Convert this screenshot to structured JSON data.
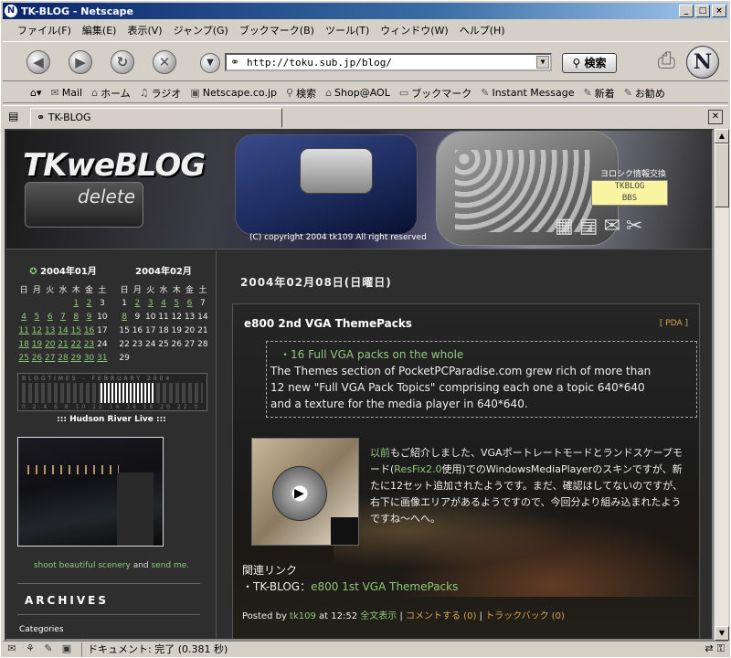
{
  "window": {
    "title": "TK-BLOG - Netscape"
  },
  "menu": [
    "ファイル(F)",
    "編集(E)",
    "表示(V)",
    "ジャンプ(G)",
    "ブックマーク(B)",
    "ツール(T)",
    "ウィンドウ(W)",
    "ヘルプ(H)"
  ],
  "nav": {
    "url": "http://toku.sub.jp/blog/",
    "search_label": "検索",
    "logo": "N"
  },
  "bookmarks": [
    {
      "icon": "mail-icon",
      "glyph": "✉",
      "label": "Mail"
    },
    {
      "icon": "home-icon",
      "glyph": "⌂",
      "label": "ホーム"
    },
    {
      "icon": "radio-icon",
      "glyph": "♫",
      "label": "ラジオ"
    },
    {
      "icon": "netscape-icon",
      "glyph": "▣",
      "label": "Netscape.co.jp"
    },
    {
      "icon": "search-icon",
      "glyph": "⚲",
      "label": "検索"
    },
    {
      "icon": "shop-icon",
      "glyph": "⌂",
      "label": "Shop@AOL"
    },
    {
      "icon": "folder-icon",
      "glyph": "▭",
      "label": "ブックマーク"
    },
    {
      "icon": "im-icon",
      "glyph": "✎",
      "label": "Instant Message"
    },
    {
      "icon": "new-icon",
      "glyph": "✎",
      "label": "新着"
    },
    {
      "icon": "rec-icon",
      "glyph": "✎",
      "label": "お勧め"
    }
  ],
  "tab": {
    "label": "TK-BLOG"
  },
  "status": {
    "text": "ドキュメント: 完了 (0.381 秒)"
  },
  "banner": {
    "logo": "TKweBLOG",
    "key_label": "delete",
    "copyright": "(C) copyright 2004 tk109 All right reserved",
    "yoroshiku": "ヨロシク情報交換",
    "bbs": "TKBLOG\nBBS"
  },
  "sidebar": {
    "cal1": {
      "title": "2004年01月",
      "days": [
        "日",
        "月",
        "火",
        "水",
        "木",
        "金",
        "土"
      ],
      "rows": [
        [
          "",
          "",
          "",
          "",
          "1",
          "2",
          "3"
        ],
        [
          "4",
          "5",
          "6",
          "7",
          "8",
          "9",
          "10"
        ],
        [
          "11",
          "12",
          "13",
          "14",
          "15",
          "16",
          "17"
        ],
        [
          "18",
          "19",
          "20",
          "21",
          "22",
          "23",
          "24"
        ],
        [
          "25",
          "26",
          "27",
          "28",
          "29",
          "30",
          "31"
        ]
      ],
      "linked": [
        "1",
        "2",
        "4",
        "5",
        "6",
        "7",
        "8",
        "9",
        "11",
        "12",
        "13",
        "14",
        "15",
        "16",
        "18",
        "19",
        "20",
        "21",
        "22",
        "23",
        "25",
        "26",
        "27",
        "28",
        "29",
        "30",
        "31"
      ]
    },
    "cal2": {
      "title": "2004年02月",
      "days": [
        "日",
        "月",
        "火",
        "水",
        "木",
        "金",
        "土"
      ],
      "rows": [
        [
          "1",
          "2",
          "3",
          "4",
          "5",
          "6",
          "7"
        ],
        [
          "8",
          "9",
          "10",
          "11",
          "12",
          "13",
          "14"
        ],
        [
          "15",
          "16",
          "17",
          "18",
          "19",
          "20",
          "21"
        ],
        [
          "22",
          "23",
          "24",
          "25",
          "26",
          "27",
          "28"
        ],
        [
          "29",
          "",
          "",
          "",
          "",
          "",
          ""
        ]
      ],
      "linked": [
        "2",
        "3",
        "4",
        "5",
        "6",
        "8"
      ]
    },
    "blogtimes_label": "BLOGTIMES - FEBRUARY 2004",
    "blogtimes_hours": "0 2 4 6 8 10 12 14 16 18 20 22 0",
    "hudson_title": "::: Hudson River Live :::",
    "shoot_a": "shoot beautiful scenery",
    "shoot_and": " and ",
    "shoot_b": "send me.",
    "archives": "ARCHIVES",
    "categories": "Categories"
  },
  "main": {
    "date": "2004年02月08日(日曜日)",
    "entry_title": "e800 2nd VGA ThemePacks",
    "entry_cat": "[ PDA ]",
    "quote_head": "・16 Full VGA packs on the whole",
    "quote_text": "The Themes section of PocketPCParadise.com grew rich of more than 12 new \"Full VGA Pack Topics\" comprising each one a topic 640*640 and a texture for the media player in 640*640.",
    "body_link": "以前",
    "body_a": "もご紹介しました、VGAポートレートモードとランドスケープモード(",
    "body_link2": "ResFix2.0",
    "body_b": "使用)でのWindowsMediaPlayerのスキンですが、新たに12セット追加されたようです。まだ、確認はしてないのですが、右下に画像エリアがあるようですので、今回分より組み込まれたようですね～へへ。",
    "related": "関連リンク",
    "related_prefix": "・TK-BLOG：",
    "related_link": "e800 1st VGA ThemePacks",
    "posted_by": "Posted by ",
    "author": "tk109",
    "posted_at": " at 12:52 ",
    "full": "全文表示",
    "sep": " | ",
    "comment": "コメントする (0)",
    "trackback": "トラックバック (0)"
  }
}
